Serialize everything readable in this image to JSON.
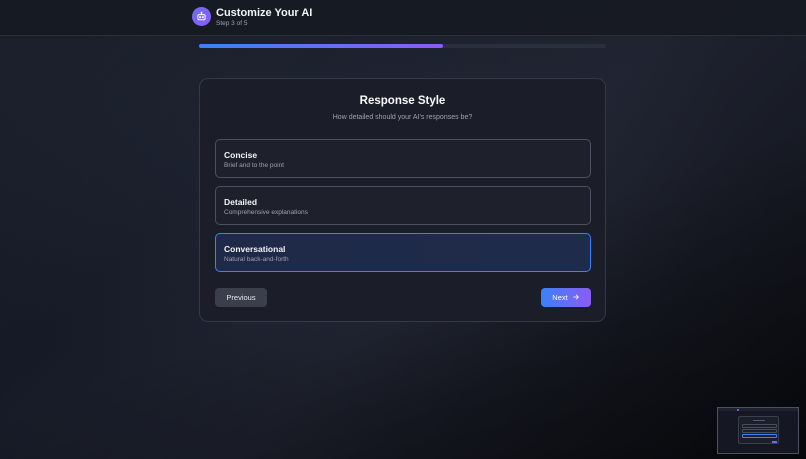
{
  "header": {
    "title": "Customize Your AI",
    "step": "Step 3 of 5",
    "icon": "robot-icon"
  },
  "progress": {
    "current_step": 3,
    "total_steps": 5,
    "fraction": 0.6,
    "gradient_start": "#3b82f6",
    "gradient_end": "#8b5cf6"
  },
  "card": {
    "title": "Response Style",
    "subtitle": "How detailed should your AI's responses be?",
    "options": [
      {
        "title": "Concise",
        "description": "Brief and to the point",
        "selected": false
      },
      {
        "title": "Detailed",
        "description": "Comprehensive explanations",
        "selected": false
      },
      {
        "title": "Conversational",
        "description": "Natural back-and-forth",
        "selected": true
      }
    ],
    "previous_label": "Previous",
    "next_label": "Next",
    "next_icon": "arrow-right-icon"
  },
  "colors": {
    "accent": "#3b82f6",
    "accent_secondary": "#8b5cf6"
  }
}
